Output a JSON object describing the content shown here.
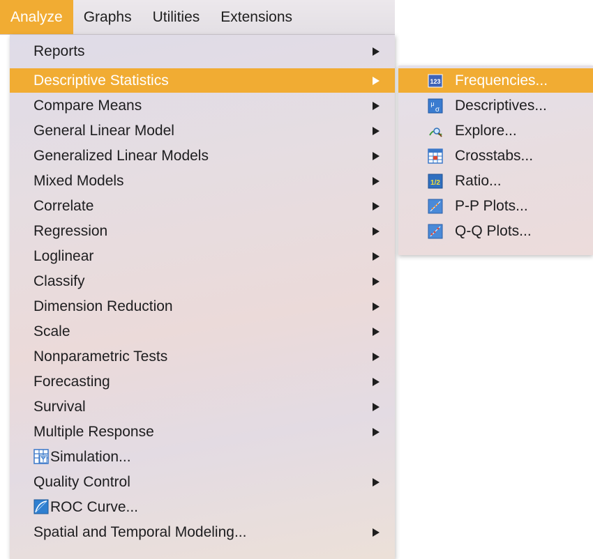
{
  "menubar": {
    "items": [
      {
        "label": "Analyze",
        "active": true
      },
      {
        "label": "Graphs",
        "active": false
      },
      {
        "label": "Utilities",
        "active": false
      },
      {
        "label": "Extensions",
        "active": false
      }
    ]
  },
  "analyze_menu": {
    "items": [
      {
        "label": "Reports",
        "submenu": true
      },
      {
        "label": "Descriptive Statistics",
        "submenu": true,
        "highlighted": true
      },
      {
        "label": "Compare Means",
        "submenu": true
      },
      {
        "label": "General Linear Model",
        "submenu": true
      },
      {
        "label": "Generalized Linear Models",
        "submenu": true
      },
      {
        "label": "Mixed Models",
        "submenu": true
      },
      {
        "label": "Correlate",
        "submenu": true
      },
      {
        "label": "Regression",
        "submenu": true
      },
      {
        "label": "Loglinear",
        "submenu": true
      },
      {
        "label": "Classify",
        "submenu": true
      },
      {
        "label": "Dimension Reduction",
        "submenu": true
      },
      {
        "label": "Scale",
        "submenu": true
      },
      {
        "label": "Nonparametric Tests",
        "submenu": true
      },
      {
        "label": "Forecasting",
        "submenu": true
      },
      {
        "label": "Survival",
        "submenu": true
      },
      {
        "label": "Multiple Response",
        "submenu": true
      },
      {
        "label": "Simulation...",
        "submenu": false,
        "icon": "simulation-icon"
      },
      {
        "label": "Quality Control",
        "submenu": true
      },
      {
        "label": "ROC Curve...",
        "submenu": false,
        "icon": "roc-curve-icon"
      },
      {
        "label": "Spatial and Temporal Modeling...",
        "submenu": true
      }
    ]
  },
  "descriptive_submenu": {
    "items": [
      {
        "label": "Frequencies...",
        "icon": "frequencies-icon",
        "highlighted": true,
        "icon_text": "123"
      },
      {
        "label": "Descriptives...",
        "icon": "descriptives-icon",
        "icon_text": "μσ"
      },
      {
        "label": "Explore...",
        "icon": "explore-icon"
      },
      {
        "label": "Crosstabs...",
        "icon": "crosstabs-icon"
      },
      {
        "label": "Ratio...",
        "icon": "ratio-icon",
        "icon_text": "1/2"
      },
      {
        "label": "P-P Plots...",
        "icon": "pp-plots-icon"
      },
      {
        "label": "Q-Q Plots...",
        "icon": "qq-plots-icon"
      }
    ]
  },
  "colors": {
    "highlight": "#f1ac33",
    "text": "#1d1d1f",
    "highlight_text": "#ffffff"
  }
}
